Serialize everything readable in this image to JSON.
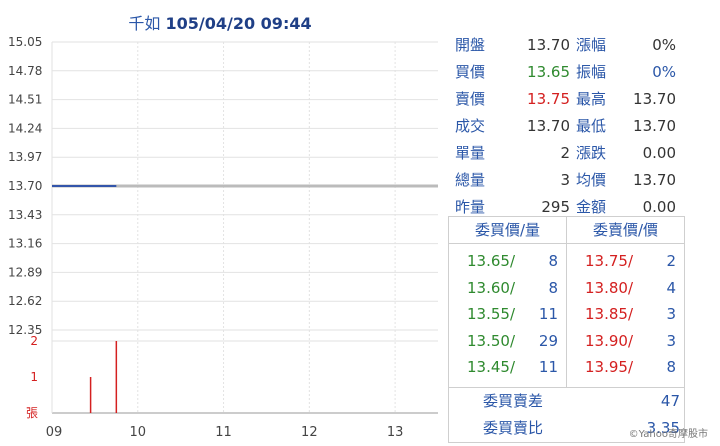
{
  "header": {
    "stock_name": "千如",
    "datetime": "105/04/20 09:44"
  },
  "info_rows": [
    {
      "label1": "開盤",
      "value1": "13.70",
      "label2": "漲幅",
      "value2": "0%"
    },
    {
      "label1": "買價",
      "value1": "13.65",
      "label2": "振幅",
      "value2": "0%"
    },
    {
      "label1": "賣價",
      "value1": "13.75",
      "label2": "最高",
      "value2": "13.70"
    },
    {
      "label1": "成交",
      "value1": "13.70",
      "label2": "最低",
      "value2": "13.70"
    },
    {
      "label1": "單量",
      "value1": "2",
      "label2": "漲跌",
      "value2": "0.00"
    },
    {
      "label1": "總量",
      "value1": "3",
      "label2": "均價",
      "value2": "13.70"
    },
    {
      "label1": "昨量",
      "value1": "295",
      "label2": "金額",
      "value2": "0.00"
    }
  ],
  "order_book": {
    "bid_header": "委買價/量",
    "ask_header": "委賣價/價",
    "bids": [
      {
        "price": "13.65/",
        "qty": "8"
      },
      {
        "price": "13.60/",
        "qty": "8"
      },
      {
        "price": "13.55/",
        "qty": "11"
      },
      {
        "price": "13.50/",
        "qty": "29"
      },
      {
        "price": "13.45/",
        "qty": "11"
      }
    ],
    "asks": [
      {
        "price": "13.75/",
        "qty": "2"
      },
      {
        "price": "13.80/",
        "qty": "4"
      },
      {
        "price": "13.85/",
        "qty": "3"
      },
      {
        "price": "13.90/",
        "qty": "3"
      },
      {
        "price": "13.95/",
        "qty": "8"
      }
    ],
    "diff_label": "委買賣差",
    "diff_value": "47",
    "ratio_label": "委買賣比",
    "ratio_value": "3.35"
  },
  "footer": {
    "credit": "©Yahoo奇摩股市"
  },
  "chart_data": {
    "type": "line",
    "price_ticks": [
      "15.05",
      "14.78",
      "14.51",
      "14.24",
      "13.97",
      "13.70",
      "13.43",
      "13.16",
      "12.89",
      "12.62",
      "12.35"
    ],
    "x_ticks": [
      "09",
      "10",
      "11",
      "12",
      "13"
    ],
    "ylim": [
      12.35,
      15.05
    ],
    "xlim": [
      9.0,
      13.5
    ],
    "price_series": {
      "name": "",
      "x": [
        9.0,
        9.75
      ],
      "y": [
        13.7,
        13.7
      ]
    },
    "reference_price": 13.7,
    "volume_ticks": [
      "2",
      "1",
      "張"
    ],
    "volume_ylim": [
      0,
      2
    ],
    "volume_bars": [
      {
        "x": 9.45,
        "v": 1
      },
      {
        "x": 9.75,
        "v": 2
      }
    ],
    "colors": {
      "price_line": "#3355aa",
      "reference_line": "#bbbbbb",
      "volume": "#d42020",
      "grid": "#e2e2e2"
    }
  }
}
